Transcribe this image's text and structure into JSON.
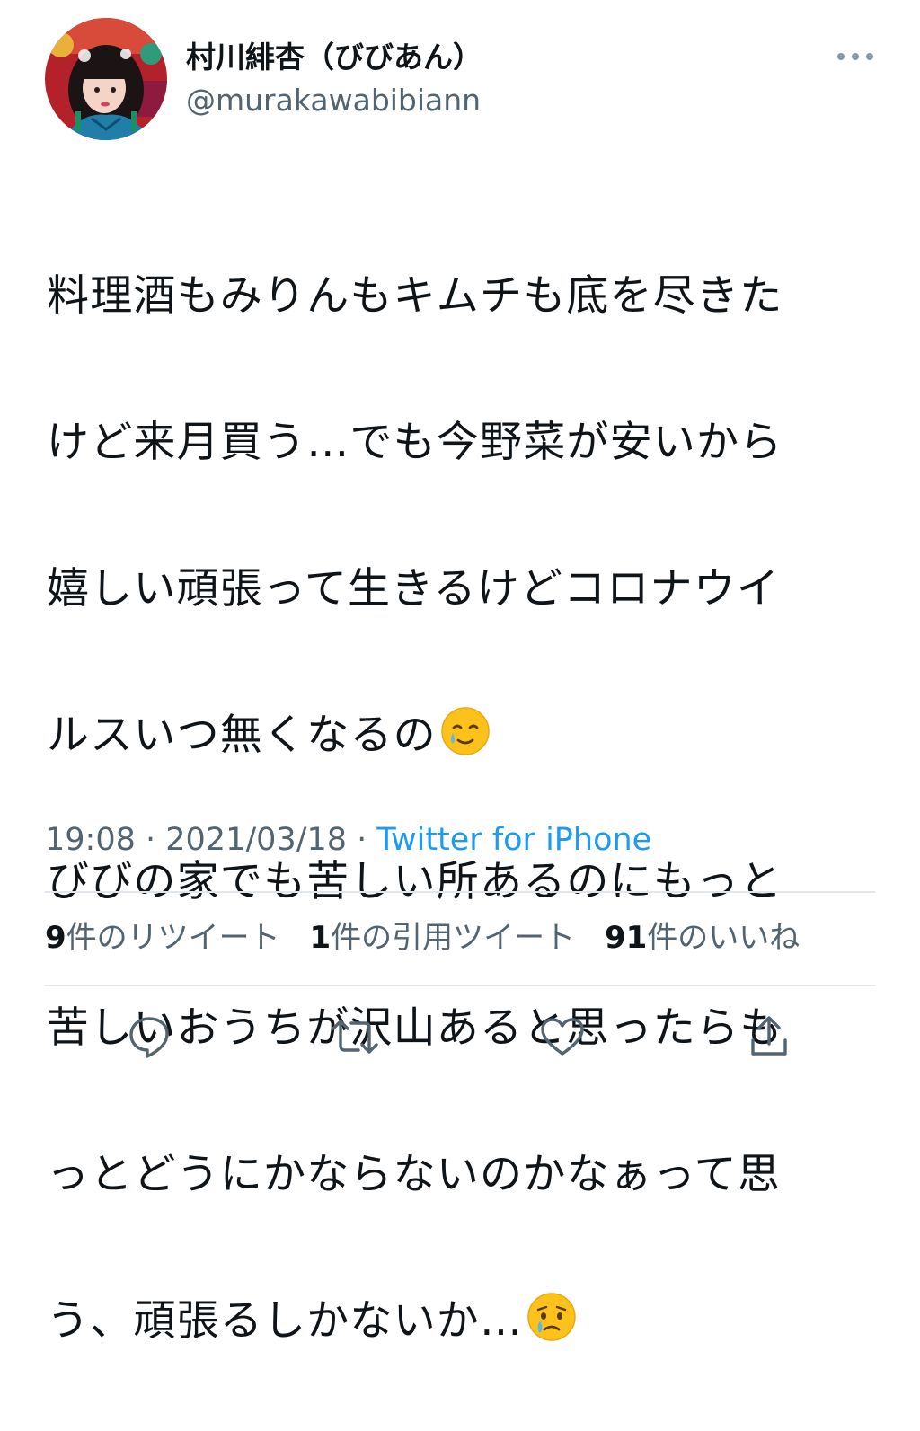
{
  "user": {
    "display_name": "村川緋杏（びびあん）",
    "handle": "@murakawabibiann",
    "avatar_icon": "profile-photo"
  },
  "header": {
    "more_icon": "more-horizontal-icon"
  },
  "tweet": {
    "lines": [
      "料理酒もみりんもキムチも底を尽きた",
      "けど来月買う…でも今野菜が安いから",
      "嬉しい頑張って生きるけどコロナウイ",
      "ルスいつ無くなるの",
      "びびの家でも苦しい所あるのにもっと",
      "苦しいおうちが沢山あると思ったらも",
      "っとどうにかならないのかなぁって思",
      "う、頑張るしかないか…"
    ],
    "emoji_line4": "smiling-face-with-tear-emoji",
    "emoji_line8": "crying-face-emoji"
  },
  "meta": {
    "time": "19:08",
    "separator": " · ",
    "date": "2021/03/18",
    "source": "Twitter for iPhone"
  },
  "stats": {
    "retweets_count": "9",
    "retweets_label": "件のリツイート",
    "quotes_count": "1",
    "quotes_label": "件の引用ツイート",
    "likes_count": "91",
    "likes_label": "件のいいね"
  },
  "actions": [
    "reply-icon",
    "retweet-icon",
    "like-icon",
    "share-icon"
  ],
  "colors": {
    "text": "#0f1419",
    "secondary": "#536471",
    "link": "#1d9bf0",
    "divider": "#e3e6e8"
  }
}
